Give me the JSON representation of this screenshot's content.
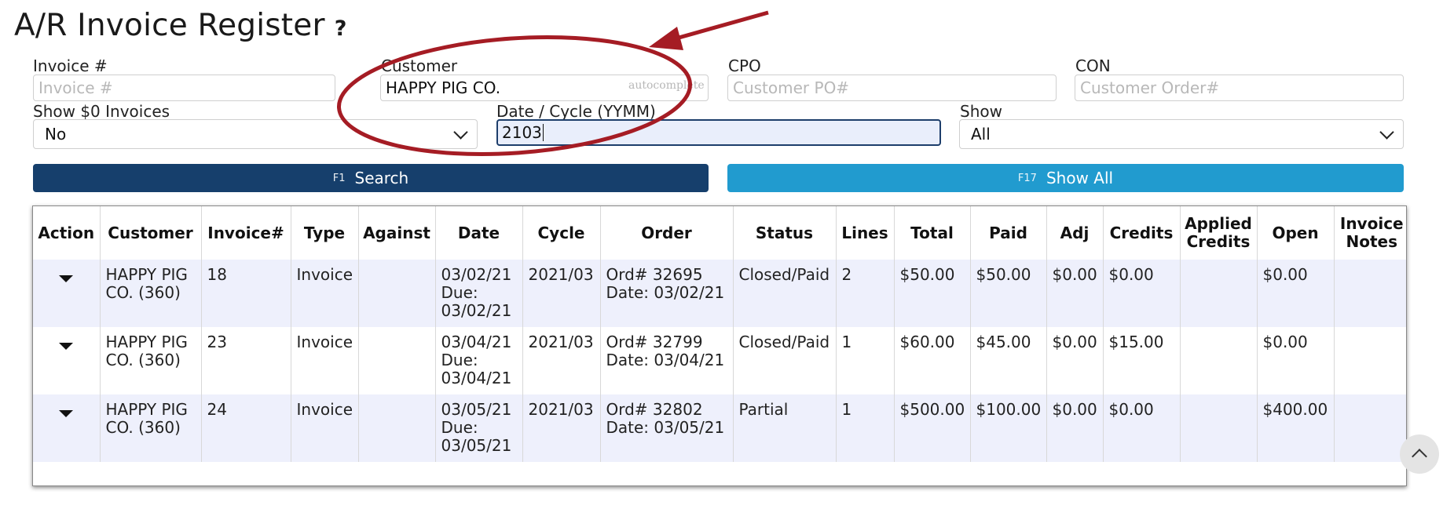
{
  "page": {
    "title": "A/R Invoice Register",
    "help_icon": "?"
  },
  "filters": {
    "invoice": {
      "label": "Invoice #",
      "placeholder": "Invoice #",
      "value": ""
    },
    "customer": {
      "label": "Customer",
      "value": "HAPPY PIG CO.",
      "hint": "autocomplete"
    },
    "cpo": {
      "label": "CPO",
      "placeholder": "Customer PO#",
      "value": ""
    },
    "con": {
      "label": "CON",
      "placeholder": "Customer Order#",
      "value": ""
    },
    "show_zero": {
      "label": "Show $0 Invoices",
      "selected": "No"
    },
    "date_cycle": {
      "label": "Date / Cycle (YYMM)",
      "value": "2103"
    },
    "show": {
      "label": "Show",
      "selected": "All"
    }
  },
  "buttons": {
    "search": {
      "key": "F1",
      "label": "Search"
    },
    "show_all": {
      "key": "F17",
      "label": "Show All"
    }
  },
  "table": {
    "columns": {
      "action": "Action",
      "customer": "Customer",
      "invoice": "Invoice#",
      "type": "Type",
      "against": "Against",
      "date": "Date",
      "cycle": "Cycle",
      "order": "Order",
      "status": "Status",
      "lines": "Lines",
      "total": "Total",
      "paid": "Paid",
      "adj": "Adj",
      "credits": "Credits",
      "applied_1": "Applied",
      "applied_2": "Credits",
      "open": "Open",
      "notes_1": "Invoice",
      "notes_2": "Notes"
    },
    "rows": [
      {
        "customer_1": "HAPPY PIG",
        "customer_2": "CO. (360)",
        "invoice": "18",
        "type": "Invoice",
        "against": "",
        "date": "03/02/21",
        "due_label": "Due:",
        "due": "03/02/21",
        "cycle": "2021/03",
        "order_1": "Ord# 32695",
        "order_2": "Date: 03/02/21",
        "status": "Closed/Paid",
        "lines": "2",
        "total": "$50.00",
        "paid": "$50.00",
        "adj": "$0.00",
        "credits": "$0.00",
        "applied": "",
        "open": "$0.00",
        "notes": ""
      },
      {
        "customer_1": "HAPPY PIG",
        "customer_2": "CO. (360)",
        "invoice": "23",
        "type": "Invoice",
        "against": "",
        "date": "03/04/21",
        "due_label": "Due:",
        "due": "03/04/21",
        "cycle": "2021/03",
        "order_1": "Ord# 32799",
        "order_2": "Date: 03/04/21",
        "status": "Closed/Paid",
        "lines": "1",
        "total": "$60.00",
        "paid": "$45.00",
        "adj": "$0.00",
        "credits": "$15.00",
        "applied": "",
        "open": "$0.00",
        "notes": ""
      },
      {
        "customer_1": "HAPPY PIG",
        "customer_2": "CO. (360)",
        "invoice": "24",
        "type": "Invoice",
        "against": "",
        "date": "03/05/21",
        "due_label": "Due:",
        "due": "03/05/21",
        "cycle": "2021/03",
        "order_1": "Ord# 32802",
        "order_2": "Date: 03/05/21",
        "status": "Partial",
        "lines": "1",
        "total": "$500.00",
        "paid": "$100.00",
        "adj": "$0.00",
        "credits": "$0.00",
        "applied": "",
        "open": "$400.00",
        "notes": ""
      }
    ]
  },
  "annotation": {
    "color": "#a51c24"
  }
}
